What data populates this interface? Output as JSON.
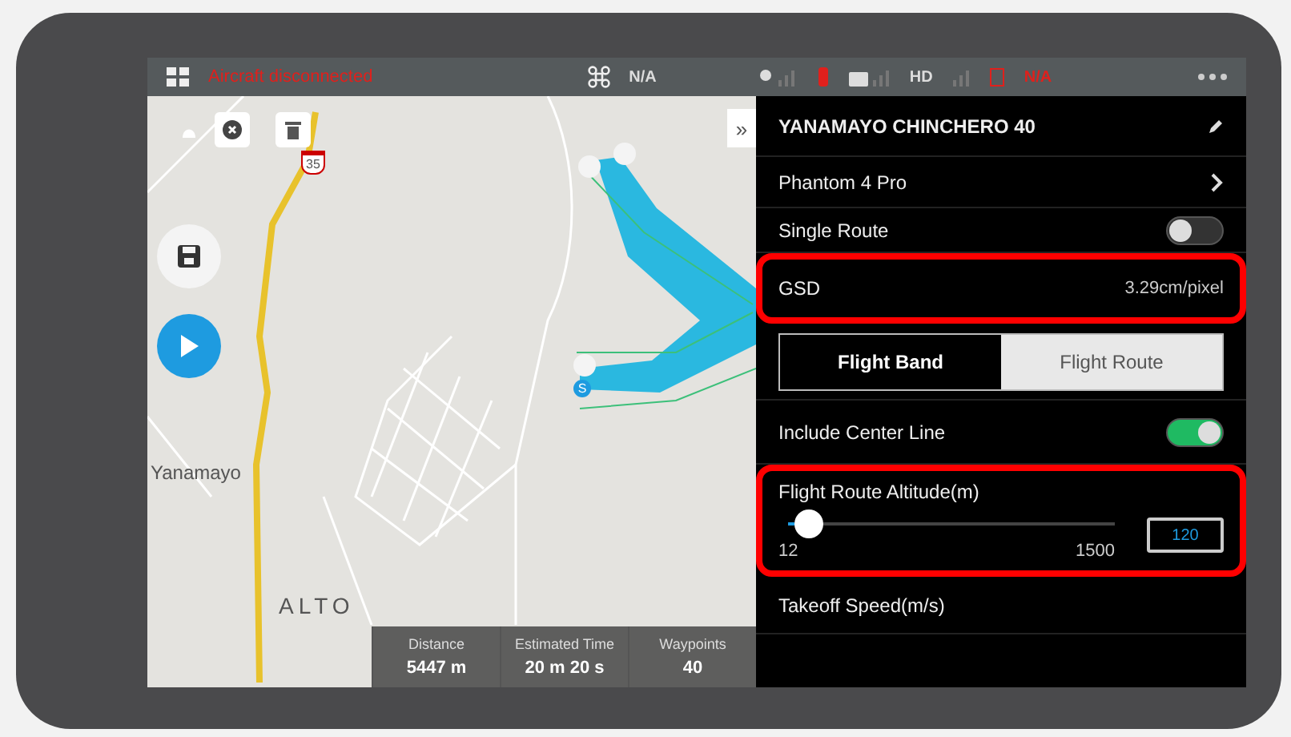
{
  "status_bar": {
    "message": "Aircraft disconnected",
    "aircraft_status": "N/A",
    "video_label": "HD",
    "battery_status": "N/A"
  },
  "map": {
    "place_labels": [
      "Yanamayo",
      "ALTO"
    ],
    "route_badge": "35",
    "expand_label": "»",
    "start_marker": "S",
    "stats": [
      {
        "label": "Distance",
        "value": "5447 m"
      },
      {
        "label": "Estimated Time",
        "value": "20 m 20 s"
      },
      {
        "label": "Waypoints",
        "value": "40"
      }
    ]
  },
  "panel": {
    "mission_name": "YANAMAYO CHINCHERO 40",
    "rows": [
      {
        "kind": "link",
        "label": "Phantom 4 Pro",
        "highlighted": false
      },
      {
        "kind": "toggle",
        "label": "Single Route",
        "on": false,
        "highlighted": false
      },
      {
        "kind": "value",
        "label": "GSD",
        "value": "3.29cm/pixel",
        "highlighted": true
      },
      {
        "kind": "segmented",
        "options": [
          {
            "label": "Flight Band",
            "selected": true
          },
          {
            "label": "Flight Route",
            "selected": false
          }
        ],
        "highlighted": false
      },
      {
        "kind": "toggle",
        "label": "Include Center Line",
        "on": true,
        "highlighted": false
      },
      {
        "kind": "slider",
        "label": "Flight Route Altitude(m)",
        "min": "12",
        "max": "1500",
        "level": 0.02,
        "value": "120",
        "highlighted": true
      },
      {
        "kind": "header",
        "label": "Takeoff Speed(m/s)",
        "highlighted": false
      }
    ]
  }
}
